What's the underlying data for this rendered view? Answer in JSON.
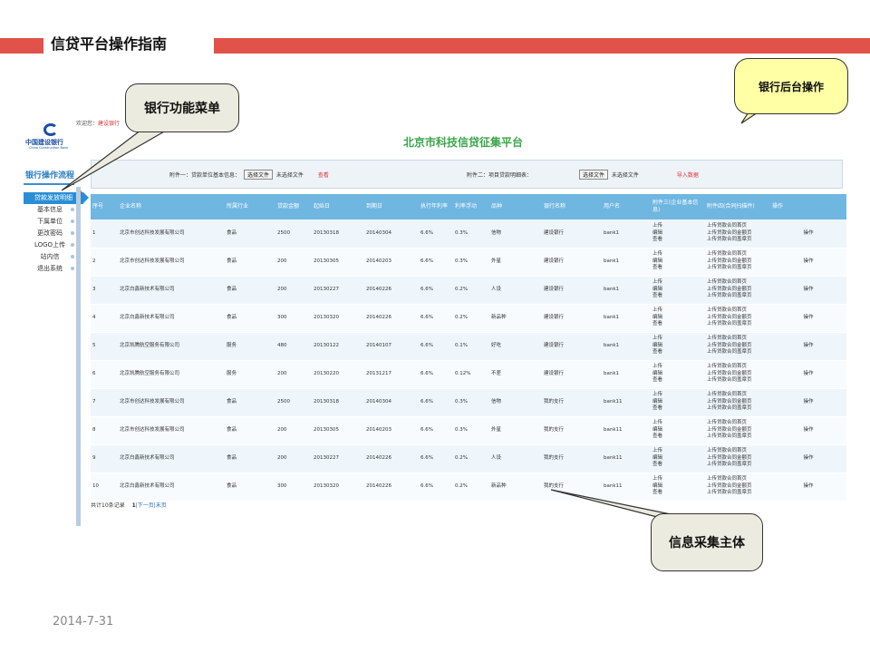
{
  "slide": {
    "title": "信贷平台操作指南",
    "date": "2014-7-31"
  },
  "callouts": {
    "bank_menu": "银行功能菜单",
    "bank_backend": "银行后台操作",
    "info_subject": "信息采集主体"
  },
  "app": {
    "logo_cn": "中国建设银行",
    "logo_en": "China Construction Bank",
    "welcome_label": "欢迎您：",
    "welcome_user": "建设银行",
    "site_title": "北京市科技信贷征集平台"
  },
  "sidebar": {
    "title": "银行操作流程",
    "items": [
      {
        "label": "贷款发放明细"
      },
      {
        "label": "基本信息"
      },
      {
        "label": "下属单位"
      },
      {
        "label": "更改密码"
      },
      {
        "label": "LOGO上传"
      },
      {
        "label": "站内信"
      },
      {
        "label": "退出系统"
      }
    ]
  },
  "upload": {
    "att1_label": "附件一：贷款单位基本信息：",
    "att1_button": "选择文件",
    "att1_status": "未选择文件",
    "att1_action": "查看",
    "att2_label": "附件二：项目贷款明细表：",
    "att2_button": "选择文件",
    "att2_status": "未选择文件",
    "att2_action": "导入数据"
  },
  "table": {
    "columns": [
      "序号",
      "企业名称",
      "所属行业",
      "贷款金额",
      "起始日",
      "到期日",
      "执行年利率",
      "利率浮动",
      "品种",
      "银行名称",
      "用户名",
      "附件三(企业基本信息)",
      "附件四(合同扫描件)",
      "操作"
    ],
    "rows": [
      {
        "no": "1",
        "company": "北京市创达科技发展有限公司",
        "industry": "食品",
        "amount": "2500",
        "start": "20130318",
        "end": "20140304",
        "rate": "6.6%",
        "float": "0.3%",
        "type": "信物",
        "bank": "建设银行",
        "user": "bank1",
        "att3": [
          "上传",
          "编辑",
          "查看"
        ],
        "att4": [
          "上传贷款合同首页",
          "上传贷款合同金额页",
          "上传贷款合同盖章页"
        ],
        "op": "操作"
      },
      {
        "no": "2",
        "company": "北京市创达科技发展有限公司",
        "industry": "食品",
        "amount": "200",
        "start": "20130305",
        "end": "20140203",
        "rate": "6.6%",
        "float": "0.3%",
        "type": "外星",
        "bank": "建设银行",
        "user": "bank1",
        "att3": [
          "上传",
          "编辑",
          "查看"
        ],
        "att4": [
          "上传贷款合同首页",
          "上传贷款合同金额页",
          "上传贷款合同盖章页"
        ],
        "op": "操作"
      },
      {
        "no": "3",
        "company": "北京白鑫新技术有限公司",
        "industry": "食品",
        "amount": "200",
        "start": "20130227",
        "end": "20140226",
        "rate": "6.6%",
        "float": "0.2%",
        "type": "人设",
        "bank": "建设银行",
        "user": "bank1",
        "att3": [
          "上传",
          "编辑",
          "查看"
        ],
        "att4": [
          "上传贷款合同首页",
          "上传贷款合同金额页",
          "上传贷款合同盖章页"
        ],
        "op": "操作"
      },
      {
        "no": "4",
        "company": "北京白鑫新技术有限公司",
        "industry": "食品",
        "amount": "300",
        "start": "20130320",
        "end": "20140226",
        "rate": "6.6%",
        "float": "0.2%",
        "type": "新品种",
        "bank": "建设银行",
        "user": "bank1",
        "att3": [
          "上传",
          "编辑",
          "查看"
        ],
        "att4": [
          "上传贷款合同首页",
          "上传贷款合同金额页",
          "上传贷款合同盖章页"
        ],
        "op": "操作"
      },
      {
        "no": "5",
        "company": "北京凯腾航空服务有限公司",
        "industry": "服务",
        "amount": "480",
        "start": "20130122",
        "end": "20140107",
        "rate": "6.6%",
        "float": "0.1%",
        "type": "好吃",
        "bank": "建设银行",
        "user": "bank1",
        "att3": [
          "上传",
          "编辑",
          "查看"
        ],
        "att4": [
          "上传贷款合同首页",
          "上传贷款合同金额页",
          "上传贷款合同盖章页"
        ],
        "op": "操作"
      },
      {
        "no": "6",
        "company": "北京凯腾航空服务有限公司",
        "industry": "服务",
        "amount": "200",
        "start": "20130220",
        "end": "20131217",
        "rate": "6.6%",
        "float": "0.12%",
        "type": "不差",
        "bank": "建设银行",
        "user": "bank1",
        "att3": [
          "上传",
          "编辑",
          "查看"
        ],
        "att4": [
          "上传贷款合同首页",
          "上传贷款合同金额页",
          "上传贷款合同盖章页"
        ],
        "op": "操作"
      },
      {
        "no": "7",
        "company": "北京市创达科技发展有限公司",
        "industry": "食品",
        "amount": "2500",
        "start": "20130318",
        "end": "20140304",
        "rate": "6.6%",
        "float": "0.3%",
        "type": "信物",
        "bank": "我的支行",
        "user": "bank11",
        "att3": [
          "上传",
          "编辑",
          "查看"
        ],
        "att4": [
          "上传贷款合同首页",
          "上传贷款合同金额页",
          "上传贷款合同盖章页"
        ],
        "op": "操作"
      },
      {
        "no": "8",
        "company": "北京市创达科技发展有限公司",
        "industry": "食品",
        "amount": "200",
        "start": "20130305",
        "end": "20140203",
        "rate": "6.6%",
        "float": "0.3%",
        "type": "外星",
        "bank": "我的支行",
        "user": "bank11",
        "att3": [
          "上传",
          "编辑",
          "查看"
        ],
        "att4": [
          "上传贷款合同首页",
          "上传贷款合同金额页",
          "上传贷款合同盖章页"
        ],
        "op": "操作"
      },
      {
        "no": "9",
        "company": "北京白鑫新技术有限公司",
        "industry": "食品",
        "amount": "200",
        "start": "20130227",
        "end": "20140226",
        "rate": "6.6%",
        "float": "0.2%",
        "type": "人设",
        "bank": "我的支行",
        "user": "bank11",
        "att3": [
          "上传",
          "编辑",
          "查看"
        ],
        "att4": [
          "上传贷款合同首页",
          "上传贷款合同金额页",
          "上传贷款合同盖章页"
        ],
        "op": "操作"
      },
      {
        "no": "10",
        "company": "北京白鑫新技术有限公司",
        "industry": "食品",
        "amount": "300",
        "start": "20130320",
        "end": "20140226",
        "rate": "6.6%",
        "float": "0.2%",
        "type": "新品种",
        "bank": "我的支行",
        "user": "bank11",
        "att3": [
          "上传",
          "编辑",
          "查看"
        ],
        "att4": [
          "上传贷款合同首页",
          "上传贷款合同金额页",
          "上传贷款合同盖章页"
        ],
        "op": "操作"
      }
    ]
  },
  "pager": {
    "total": "共计10条记录",
    "page": "1",
    "nav": "|下一页|末页"
  }
}
